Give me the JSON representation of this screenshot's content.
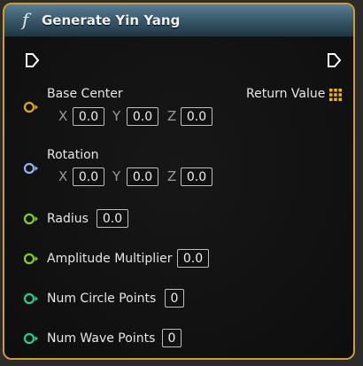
{
  "node": {
    "title": "Generate Yin Yang",
    "function_icon": "f",
    "return_value_label": "Return Value"
  },
  "inputs": {
    "base_center": {
      "label": "Base Center",
      "x_axis": "X",
      "y_axis": "Y",
      "z_axis": "Z",
      "x": "0.0",
      "y": "0.0",
      "z": "0.0"
    },
    "rotation": {
      "label": "Rotation",
      "x_axis": "X",
      "y_axis": "Y",
      "z_axis": "Z",
      "x": "0.0",
      "y": "0.0",
      "z": "0.0"
    },
    "radius": {
      "label": "Radius",
      "value": "0.0"
    },
    "amplitude_multiplier": {
      "label": "Amplitude Multiplier",
      "value": "0.0"
    },
    "num_circle_points": {
      "label": "Num Circle Points",
      "value": "0"
    },
    "num_wave_points": {
      "label": "Num Wave Points",
      "value": "0"
    }
  },
  "colors": {
    "border": "#d6992b",
    "vector_pin": "#e0a81c",
    "rotator_pin": "#9aaef0",
    "float_pin": "#7ed321",
    "int_pin": "#1fcf9c",
    "return_pin": "#f0b800"
  }
}
